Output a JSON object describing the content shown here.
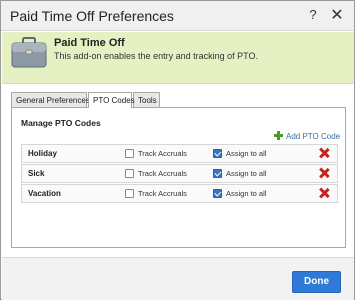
{
  "window": {
    "title": "Paid Time Off Preferences",
    "help_label": "?",
    "close_label": "✕"
  },
  "banner": {
    "title": "Paid Time Off",
    "description": "This add-on enables the entry and tracking of PTO.",
    "icon": "briefcase-icon"
  },
  "tabs": [
    {
      "label": "General Preferences",
      "active": false
    },
    {
      "label": "PTO Codes",
      "active": true
    },
    {
      "label": "Tools",
      "active": false
    }
  ],
  "panel": {
    "heading": "Manage PTO Codes",
    "add_label": "Add PTO Code",
    "track_label": "Track Accruals",
    "assign_label": "Assign to all",
    "codes": [
      {
        "name": "Holiday",
        "track_accruals": false,
        "assign_to_all": true
      },
      {
        "name": "Sick",
        "track_accruals": false,
        "assign_to_all": true
      },
      {
        "name": "Vacation",
        "track_accruals": false,
        "assign_to_all": true
      }
    ]
  },
  "footer": {
    "done_label": "Done"
  },
  "colors": {
    "banner_bg": "#e5f1c3",
    "primary_button": "#2f7ad6",
    "delete": "#c9221e",
    "add": "#4a9a2a",
    "link": "#3a6ea5"
  }
}
